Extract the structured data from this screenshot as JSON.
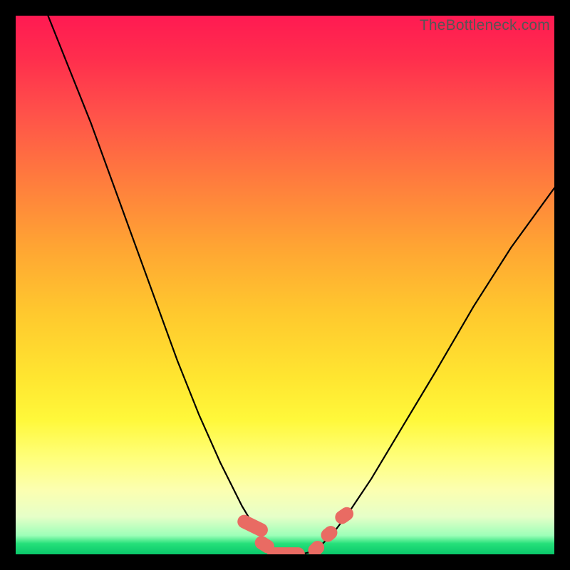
{
  "watermark": "TheBottleneck.com",
  "chart_data": {
    "type": "line",
    "title": "",
    "xlabel": "",
    "ylabel": "",
    "xlim": [
      0,
      100
    ],
    "ylim": [
      0,
      100
    ],
    "series": [
      {
        "name": "bottleneck-curve",
        "x": [
          6,
          10,
          14,
          18,
          22,
          26,
          30,
          34,
          38,
          42,
          45,
          47,
          49,
          51,
          53,
          55,
          57,
          59,
          62,
          66,
          72,
          78,
          85,
          92,
          100
        ],
        "values": [
          100,
          90,
          80,
          69,
          58,
          47,
          36,
          26,
          17,
          9,
          4,
          1.5,
          0.3,
          0,
          0,
          0.5,
          2,
          4,
          8,
          14,
          24,
          34,
          46,
          57,
          68
        ]
      }
    ],
    "markers": {
      "name": "bottleneck-zone-markers",
      "color": "#e96b63",
      "points": [
        {
          "x": 44.0,
          "y": 5.3,
          "w": 2.5,
          "h": 6.0,
          "angle": -64
        },
        {
          "x": 46.2,
          "y": 1.8,
          "w": 2.5,
          "h": 3.8,
          "angle": -58
        },
        {
          "x": 50.2,
          "y": 0.0,
          "w": 7.0,
          "h": 2.6,
          "angle": 0
        },
        {
          "x": 55.8,
          "y": 1.0,
          "w": 2.5,
          "h": 3.2,
          "angle": 45
        },
        {
          "x": 58.2,
          "y": 3.8,
          "w": 2.5,
          "h": 3.2,
          "angle": 50
        },
        {
          "x": 61.0,
          "y": 7.2,
          "w": 2.5,
          "h": 3.6,
          "angle": 55
        }
      ]
    }
  }
}
